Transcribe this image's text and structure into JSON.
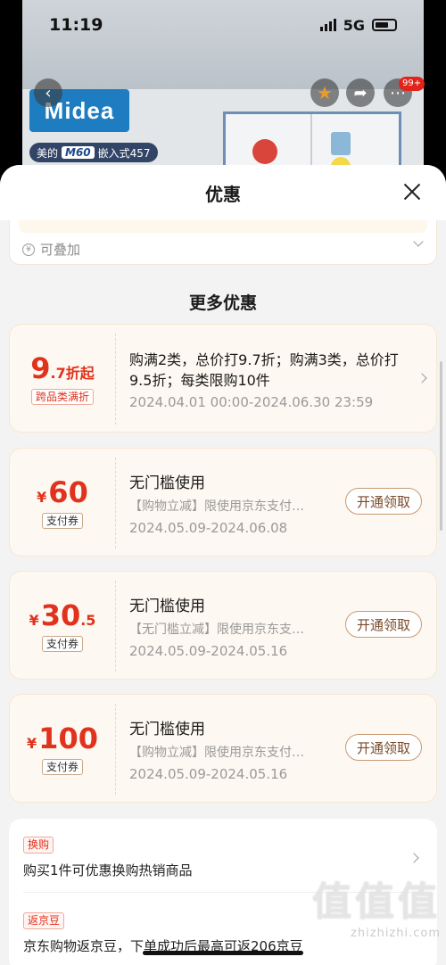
{
  "status_bar": {
    "time": "11:19",
    "network": "5G"
  },
  "product_bg": {
    "brand": "Midea",
    "tag_prefix": "美的",
    "model": "M60",
    "tag_suffix": "嵌入式457",
    "badge": "99+"
  },
  "sheet": {
    "title": "优惠"
  },
  "stack_card": {
    "label": "可叠加"
  },
  "more_section": {
    "title": "更多优惠"
  },
  "discount_card": {
    "value_big": "9",
    "value_small": ".7折起",
    "tag": "跨品类满折",
    "description": "购满2类，总价打9.7折；购满3类，总价打9.5折；每类限购10件",
    "date": "2024.04.01 00:00-2024.06.30 23:59"
  },
  "coupons": [
    {
      "currency": "¥",
      "amount": "60",
      "decimal": "",
      "tag": "支付券",
      "title": "无门槛使用",
      "desc": "【购物立减】限使用京东支付…",
      "date": "2024.05.09-2024.06.08",
      "button": "开通领取"
    },
    {
      "currency": "¥",
      "amount": "30",
      "decimal": ".5",
      "tag": "支付券",
      "title": "无门槛使用",
      "desc": "【无门槛立减】限使用京东支…",
      "date": "2024.05.09-2024.05.16",
      "button": "开通领取"
    },
    {
      "currency": "¥",
      "amount": "100",
      "decimal": "",
      "tag": "支付券",
      "title": "无门槛使用",
      "desc": "【购物立减】限使用京东支付…",
      "date": "2024.05.09-2024.05.16",
      "button": "开通领取"
    }
  ],
  "misc": [
    {
      "tag": "换购",
      "text": "购买1件可优惠换购热销商品"
    },
    {
      "tag": "返京豆",
      "text": "京东购物返京豆，下单成功后最高可返206京豆"
    }
  ],
  "watermark": {
    "big": "值值值",
    "small": "zhizhizhi.com"
  }
}
